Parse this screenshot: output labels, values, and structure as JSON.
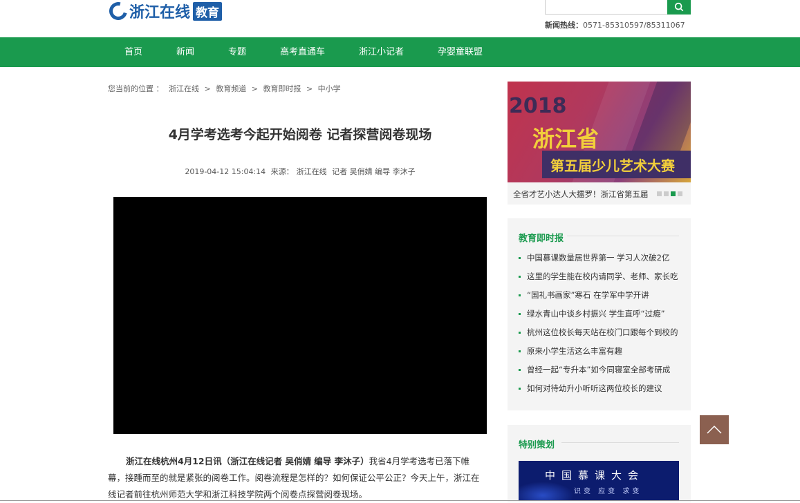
{
  "header": {
    "logo_text": "浙江在线",
    "logo_badge": "教育",
    "search_placeholder": "",
    "hotline_label": "新闻热线：",
    "hotline_number": "0571-85310597/85311067"
  },
  "nav": {
    "items": [
      {
        "label": "首页"
      },
      {
        "label": "新闻"
      },
      {
        "label": "专题"
      },
      {
        "label": "高考直通车"
      },
      {
        "label": "浙江小记者"
      },
      {
        "label": "孕婴童联盟"
      }
    ]
  },
  "breadcrumb": {
    "prefix": "您当前的位置 ：",
    "items": [
      "浙江在线",
      "教育频道",
      "教育即时报",
      "中小学"
    ],
    "separator": ">"
  },
  "article": {
    "title": "4月学考选考今起开始阅卷 记者探营阅卷现场",
    "datetime": "2019-04-12 15:04:14",
    "source_label": "来源：",
    "source": "浙江在线",
    "byline": "记者 吴俏婧 编导 李沐子",
    "lead_bold": "浙江在线杭州4月12日讯（浙江在线记者 吴俏婧 编导 李沐子）",
    "lead_text": "我省4月学考选考已落下帷幕，接踵而至的就是紧张的阅卷工作。阅卷流程是怎样的？如何保证公平公正？今天上午，浙江在线记者前往杭州师范大学和浙江科技学院两个阅卷点探营阅卷现场。"
  },
  "carousel": {
    "banner_year": "2018",
    "banner_province": "浙江省",
    "banner_event": "第五届少儿艺术大赛",
    "caption": "全省才艺小达人大擂罗！浙江省第五届",
    "active_dot": 3,
    "dot_count": 4
  },
  "news_panel": {
    "title": "教育即时报",
    "items": [
      "中国慕课数量居世界第一 学习人次破2亿",
      "这里的学生能在校内请同学、老师、家长吃",
      "“国礼书画家”寒石 在学军中学开讲",
      "绿水青山中谈乡村振兴 学生直呼“过瘾”",
      "杭州这位校长每天站在校门口跟每个到校的",
      "原来小学生活这么丰富有趣",
      "曾经一起“专升本”如今同寝室全部考研成",
      "如何对待幼升小听听这两位校长的建议"
    ]
  },
  "special_panel": {
    "title": "特别策划",
    "banner_title": "中国慕课大会",
    "banner_subtitle": "识变 应变 求变"
  }
}
